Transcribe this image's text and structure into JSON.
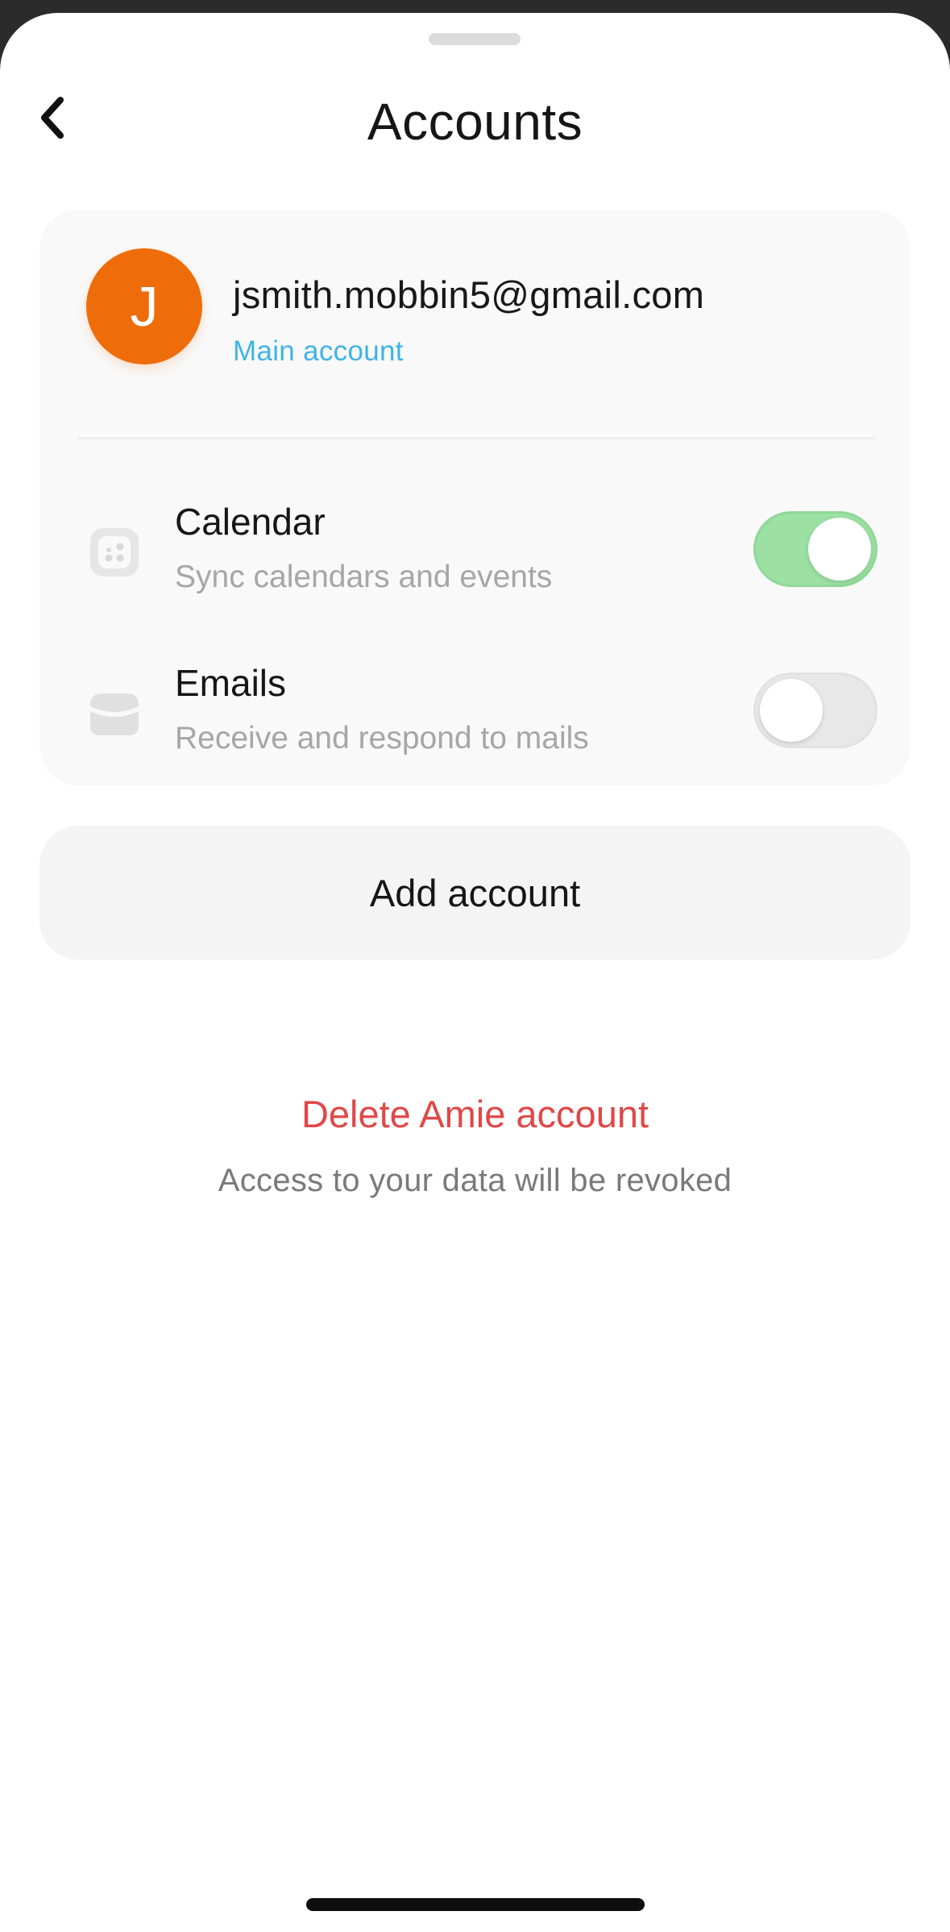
{
  "header": {
    "title": "Accounts"
  },
  "account": {
    "initial": "J",
    "email": "jsmith.mobbin5@gmail.com",
    "role": "Main account",
    "avatar_color": "#ee6d0a"
  },
  "services": [
    {
      "title": "Calendar",
      "subtitle": "Sync calendars and events",
      "icon": "calendar-icon",
      "enabled": true
    },
    {
      "title": "Emails",
      "subtitle": "Receive and respond to mails",
      "icon": "inbox-icon",
      "enabled": false
    }
  ],
  "actions": {
    "add_account_label": "Add account",
    "delete_label": "Delete Amie account",
    "delete_note": "Access to your data will be revoked"
  },
  "colors": {
    "accent_blue": "#3fb4e6",
    "toggle_on": "#9ce0a3",
    "danger": "#e04848"
  }
}
